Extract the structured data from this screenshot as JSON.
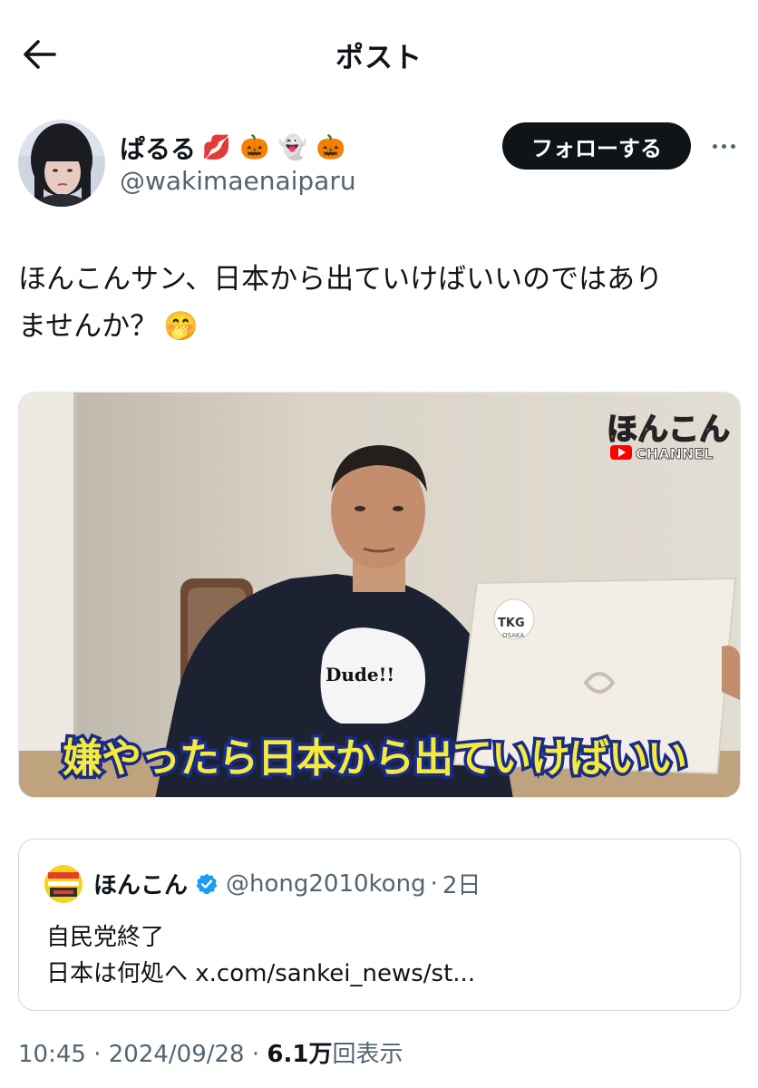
{
  "header": {
    "title": "ポスト"
  },
  "author": {
    "display_name": "ぱるる",
    "emojis": [
      "💋",
      "🎃",
      "👻",
      "🎃"
    ],
    "handle": "@wakimaenaiparu",
    "follow_label": "フォローする"
  },
  "tweet": {
    "text_line1": "ほんこんサン、日本から出ていけばいいのではあり",
    "text_line2": "ませんか？",
    "text_emoji": "🤭"
  },
  "media": {
    "logo_line1": "ほんこん",
    "logo_line2": "CHANNEL",
    "laptop_sticker": "TKG",
    "laptop_sticker_sub": "OSAKA",
    "shirt_text": "Dude!!",
    "caption": "嫌やったら日本から出ていけばいい"
  },
  "quote": {
    "name": "ほんこん",
    "handle": "@hong2010kong",
    "separator": "·",
    "time": "2日",
    "line1": "自民党終了",
    "line2": "日本は何処へ x.com/sankei_news/st..."
  },
  "meta": {
    "time": "10:45",
    "sep1": " · ",
    "date": "2024/09/28",
    "sep2": " · ",
    "views": "6.1万",
    "views_label": "回表示"
  },
  "colors": {
    "text": "#0f1419",
    "secondary": "#536471",
    "verified": "#1d9bf0",
    "caption_fill": "#f3ea3c",
    "caption_stroke": "#1a2b8a"
  },
  "icons": {
    "back": "arrow-left-icon",
    "more": "more-horizontal-icon",
    "verified": "verified-badge-icon"
  }
}
